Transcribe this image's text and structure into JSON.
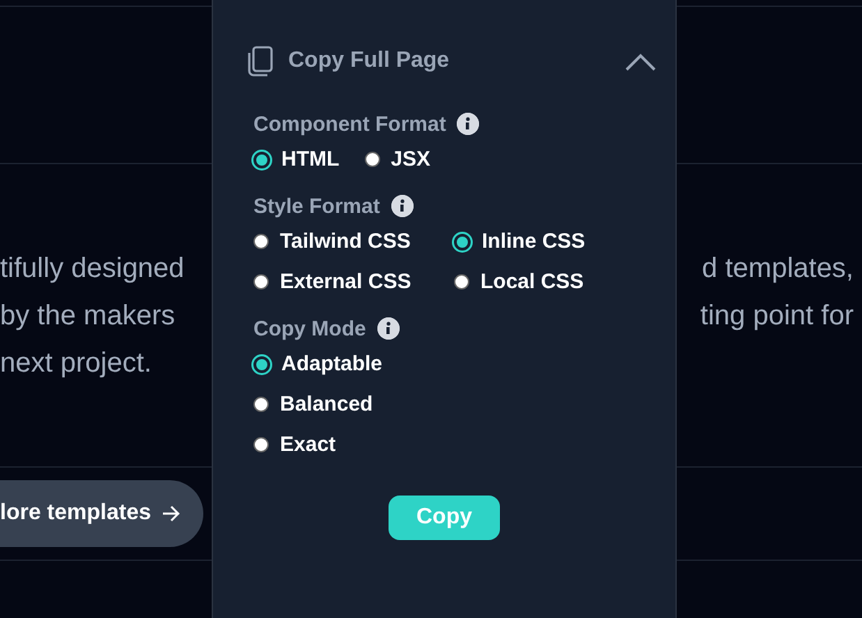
{
  "background": {
    "paragraph_lines": [
      {
        "left": "tifully designed",
        "right": "d templates,"
      },
      {
        "left": "by the makers",
        "right": "ting point for"
      },
      {
        "left": "next project."
      }
    ],
    "button": {
      "label": "lore templates"
    }
  },
  "panel": {
    "title": "Copy Full Page",
    "expanded": true,
    "sections": [
      {
        "label": "Component Format",
        "kind": "inline",
        "options": [
          {
            "label": "HTML",
            "selected": true
          },
          {
            "label": "JSX",
            "selected": false
          }
        ]
      },
      {
        "label": "Style Format",
        "kind": "grid",
        "options": [
          {
            "label": "Tailwind CSS",
            "selected": false
          },
          {
            "label": "Inline CSS",
            "selected": true
          },
          {
            "label": "External CSS",
            "selected": false
          },
          {
            "label": "Local CSS",
            "selected": false
          }
        ]
      },
      {
        "label": "Copy Mode",
        "kind": "stack",
        "options": [
          {
            "label": "Adaptable",
            "selected": true
          },
          {
            "label": "Balanced",
            "selected": false
          },
          {
            "label": "Exact",
            "selected": false
          }
        ]
      }
    ],
    "copy_button": "Copy"
  }
}
